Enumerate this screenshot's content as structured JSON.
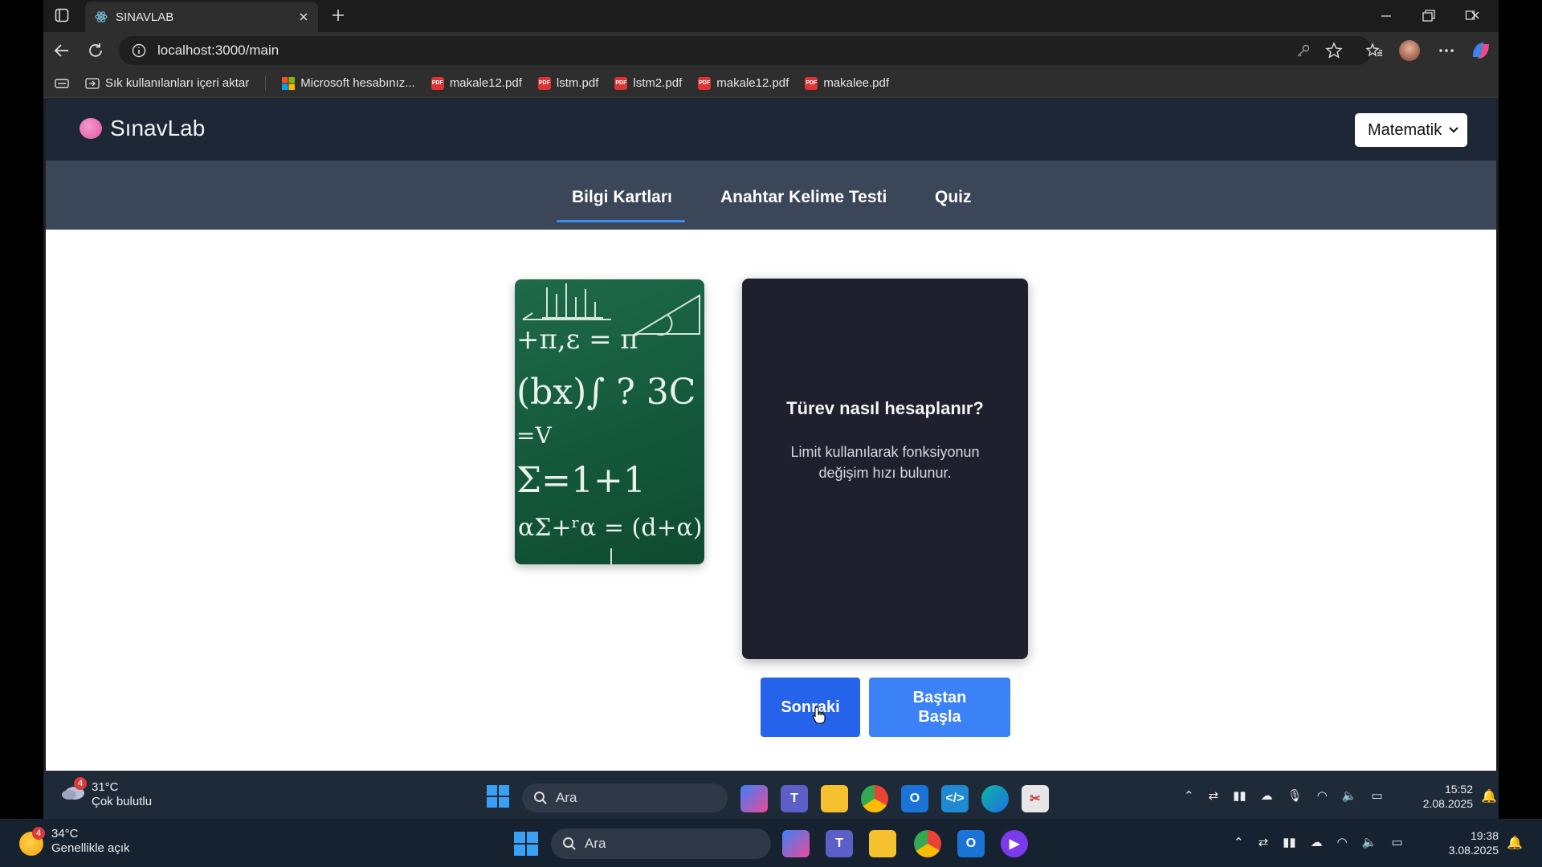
{
  "browser": {
    "tab_title": "SINAVLAB",
    "url": "localhost:3000/main",
    "bookmarks": [
      {
        "label": "Sık kullanılanları içeri aktar",
        "icon": "import-icon"
      },
      {
        "label": "Microsoft hesabınız...",
        "icon": "microsoft-icon"
      },
      {
        "label": "makale12.pdf",
        "icon": "pdf-icon"
      },
      {
        "label": "lstm.pdf",
        "icon": "pdf-icon"
      },
      {
        "label": "lstm2.pdf",
        "icon": "pdf-icon"
      },
      {
        "label": "makale12.pdf",
        "icon": "pdf-icon"
      },
      {
        "label": "makalee.pdf",
        "icon": "pdf-icon"
      }
    ]
  },
  "app": {
    "brand": "SınavLab",
    "subject_selected": "Matematik",
    "nav": {
      "flashcards": "Bilgi Kartları",
      "keyword_test": "Anahtar Kelime Testi",
      "quiz": "Quiz"
    },
    "image_chalk": {
      "l1": "+π,ε = π",
      "l2": "(bx)∫ ?  3C",
      "l3": "=V",
      "l4": "Σ=1+1",
      "l5": "αΣ+ʳα = (d+α)"
    },
    "card": {
      "question": "Türev nasıl hesaplanır?",
      "answer": "Limit kullanılarak fonksiyonun değişim hızı bulunur."
    },
    "buttons": {
      "next": "Sonraki",
      "restart": "Baştan Başla"
    }
  },
  "inner_taskbar": {
    "weather_temp": "31°C",
    "weather_desc": "Çok bulutlu",
    "weather_badge": "4",
    "search": "Ara",
    "time": "15:52",
    "date": "2.08.2025"
  },
  "outer_taskbar": {
    "weather_temp": "34°C",
    "weather_desc": "Genellikle açık",
    "weather_badge": "4",
    "search": "Ara",
    "time": "19:38",
    "date": "3.08.2025"
  },
  "colors": {
    "header_bg": "#1e2736",
    "nav_bg": "#3b4658",
    "card_bg": "#1f1f2e",
    "next_btn": "#2563eb",
    "restart_btn": "#3b82f6",
    "nav_underline": "#3a8cf0"
  }
}
